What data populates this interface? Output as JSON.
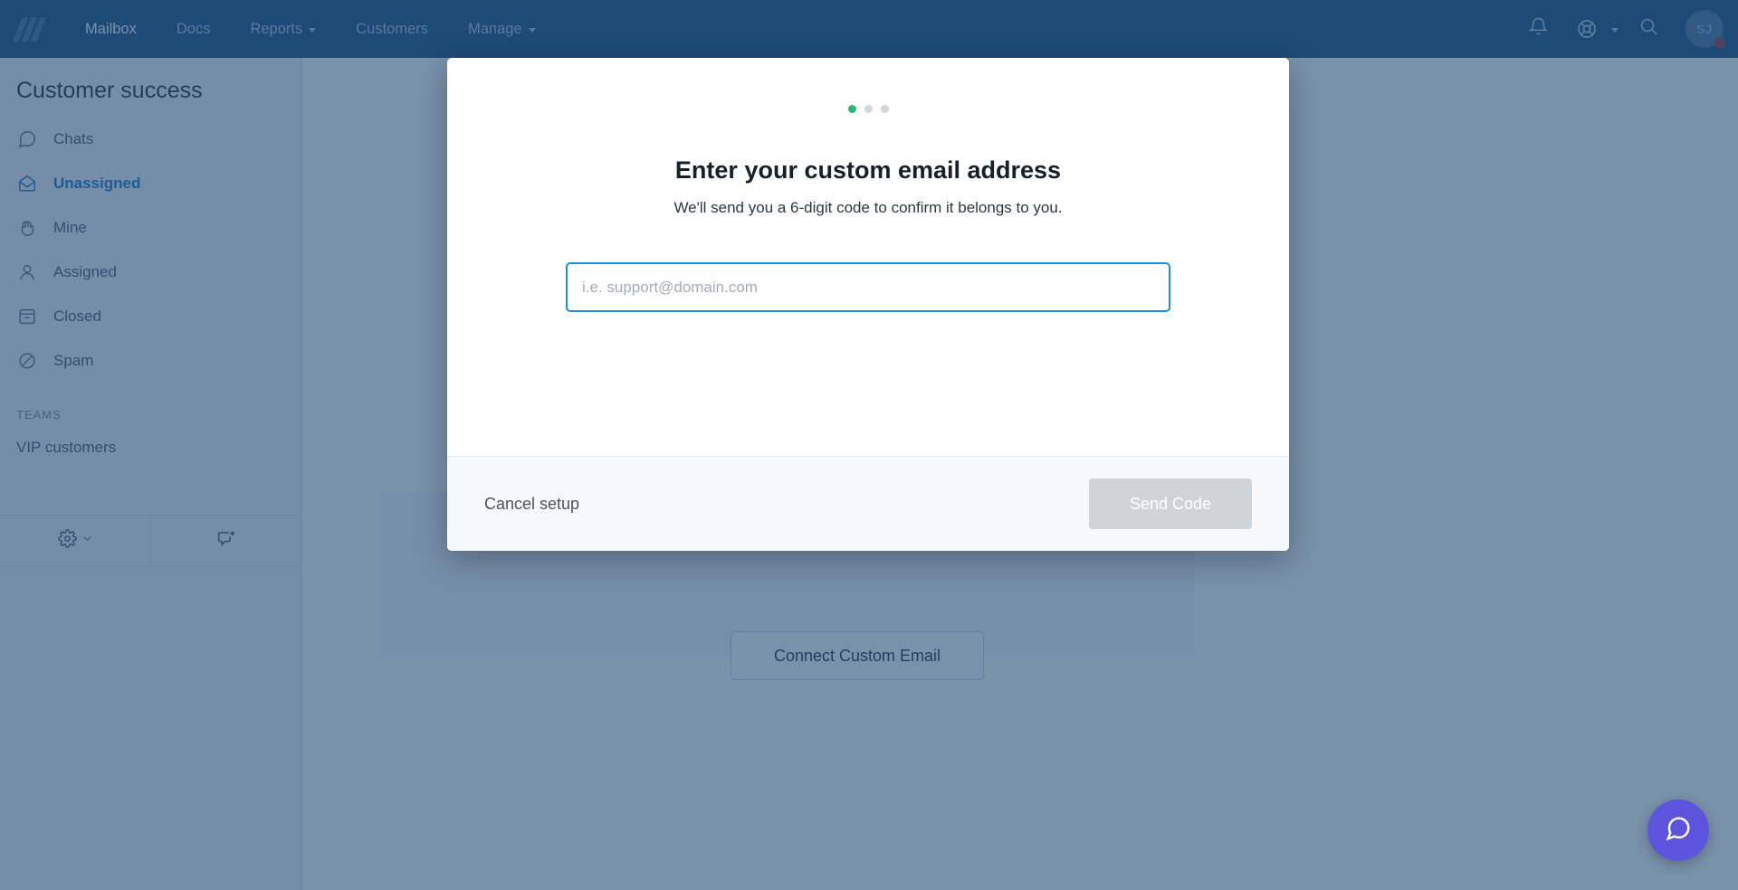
{
  "topnav": {
    "logo_name": "helpscout-logo",
    "links": [
      {
        "label": "Mailbox",
        "active": true,
        "caret": false
      },
      {
        "label": "Docs",
        "active": false,
        "caret": false
      },
      {
        "label": "Reports",
        "active": false,
        "caret": true
      },
      {
        "label": "Customers",
        "active": false,
        "caret": false
      },
      {
        "label": "Manage",
        "active": false,
        "caret": true
      }
    ],
    "icons": {
      "notifications": "bell-icon",
      "help": "lifebuoy-icon",
      "search": "search-icon"
    },
    "avatar": {
      "initials": "SJ",
      "badge": true
    },
    "bg_color": "#0f4475"
  },
  "sidebar": {
    "title": "Customer success",
    "items": [
      {
        "label": "Chats",
        "icon": "chat-bubble-icon",
        "active": false
      },
      {
        "label": "Unassigned",
        "icon": "open-envelope-icon",
        "active": true
      },
      {
        "label": "Mine",
        "icon": "hand-icon",
        "active": false
      },
      {
        "label": "Assigned",
        "icon": "person-icon",
        "active": false
      },
      {
        "label": "Closed",
        "icon": "archive-box-icon",
        "active": false
      },
      {
        "label": "Spam",
        "icon": "slash-circle-icon",
        "active": false
      }
    ],
    "section_label": "TEAMS",
    "teams": [
      {
        "label": "VIP customers"
      }
    ],
    "footer": {
      "settings_icon": "gear-icon",
      "new_conversation_icon": "new-conversation-icon"
    },
    "active_color": "#1173c4"
  },
  "main": {
    "connect_button_label": "Connect Custom Email"
  },
  "modal": {
    "steps": [
      {
        "state": "done"
      },
      {
        "state": "pending"
      },
      {
        "state": "pending"
      }
    ],
    "title": "Enter your custom email address",
    "subtitle": "We'll send you a 6-digit code to confirm it belongs to you.",
    "email_placeholder": "i.e. support@domain.com",
    "email_value": "",
    "cancel_label": "Cancel setup",
    "send_label": "Send Code",
    "active_step_color": "#2bb673",
    "focus_border_color": "#1f8ddb"
  },
  "beacon": {
    "icon": "chat-bubble-icon",
    "color": "#5d54de"
  }
}
